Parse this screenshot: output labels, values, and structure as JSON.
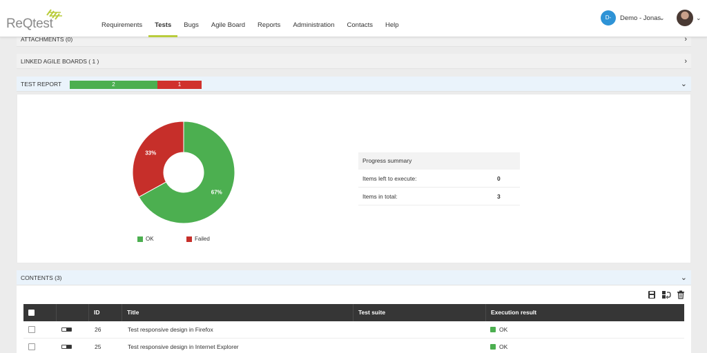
{
  "app": {
    "logo_text": "ReQtest",
    "nav": [
      "Requirements",
      "Tests",
      "Bugs",
      "Agile Board",
      "Reports",
      "Administration",
      "Contacts",
      "Help"
    ],
    "active_nav": "Tests",
    "user_initials": "D-",
    "user_name": "Demo - Jonas"
  },
  "sections": {
    "attachments": "ATTACHMENTS (0)",
    "linked_boards": "LINKED AGILE BOARDS ( 1 )",
    "test_report": "TEST REPORT",
    "contents": "CONTENTS (3)"
  },
  "report_bar": {
    "ok_count": "2",
    "failed_count": "1",
    "ok_color": "#4caf50",
    "failed_color": "#d0312d"
  },
  "chart_data": {
    "type": "pie",
    "categories": [
      "OK",
      "Failed"
    ],
    "values": [
      67,
      33
    ],
    "labels": [
      "67%",
      "33%"
    ],
    "colors": [
      "#4caf50",
      "#c62f2a"
    ]
  },
  "summary": {
    "title": "Progress summary",
    "rows": [
      {
        "label": "Items left to execute:",
        "value": "0"
      },
      {
        "label": "Items in total:",
        "value": "3"
      }
    ]
  },
  "table": {
    "headers": [
      "ID",
      "Title",
      "Test suite",
      "Execution result"
    ],
    "rows": [
      {
        "id": "26",
        "title": "Test responsive design in Firefox",
        "suite": "",
        "result": "OK"
      },
      {
        "id": "25",
        "title": "Test responsive design in Internet Explorer",
        "suite": "",
        "result": "OK"
      }
    ]
  },
  "icons": {
    "save": "save-icon",
    "move": "move-icon",
    "delete": "trash-icon"
  }
}
